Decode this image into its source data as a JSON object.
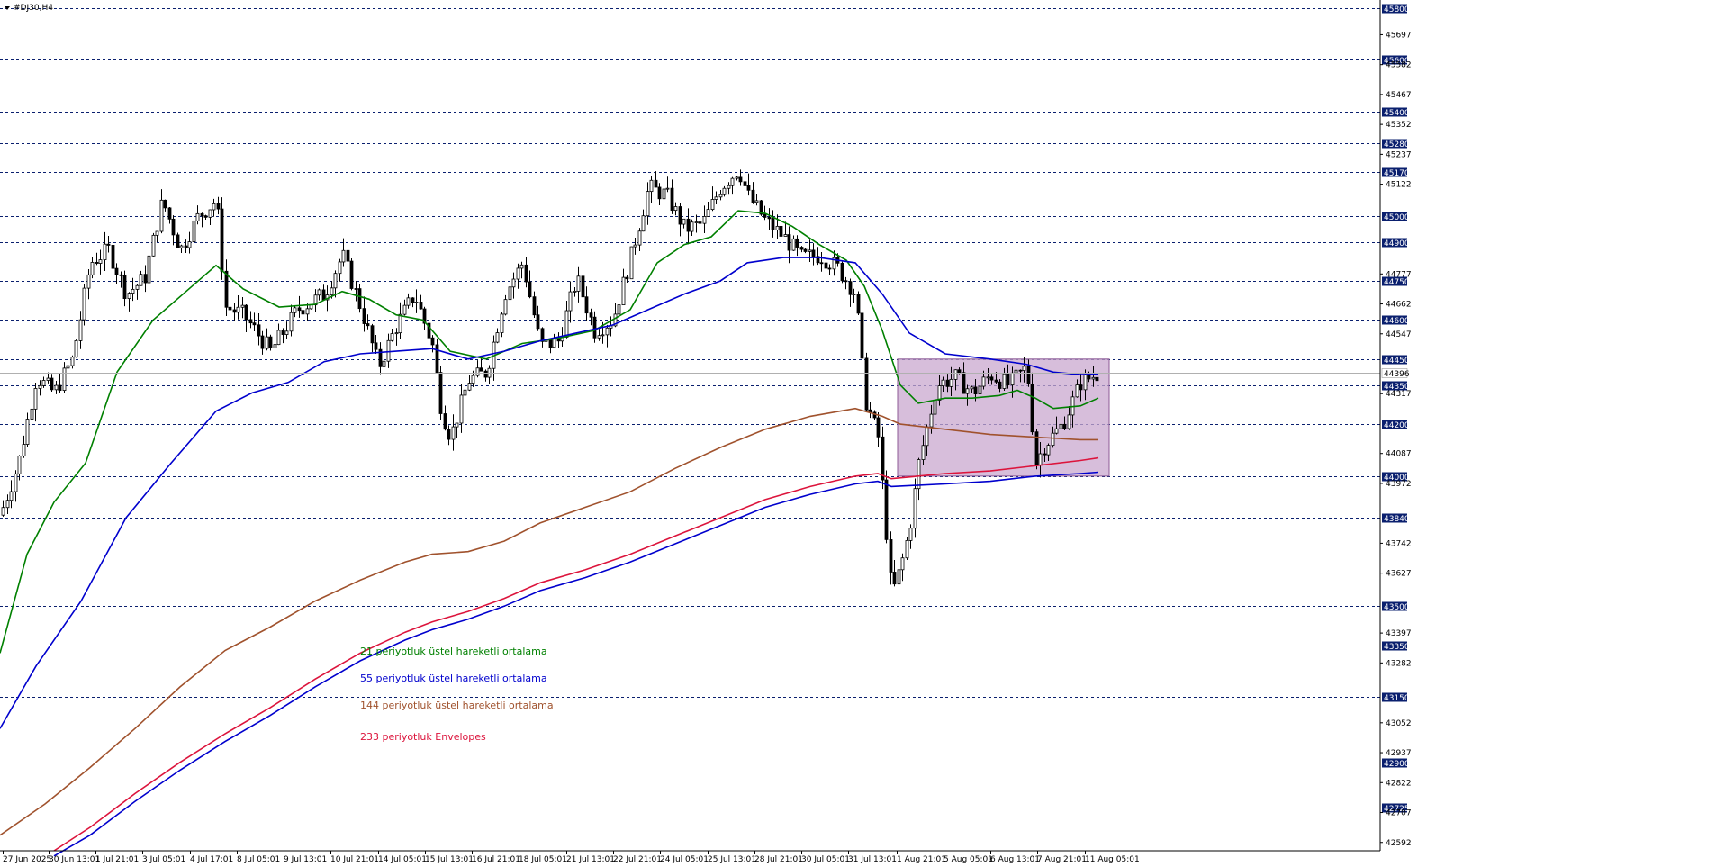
{
  "symbol": "#DJ30,H4",
  "chart_data": {
    "type": "candlestick",
    "ylim": [
      42560,
      45830
    ],
    "grid": true,
    "highlighted_levels": [
      45800,
      45600,
      45400,
      45280,
      45170,
      45000,
      44900,
      44750,
      44600,
      44450,
      44350,
      44200,
      44000,
      43840,
      43500,
      43350,
      43150,
      42900,
      42725
    ],
    "minor_levels": [
      45697,
      45582,
      45467,
      45352,
      45237,
      45122,
      44777,
      44662,
      44547,
      44317,
      44087,
      43972,
      43742,
      43627,
      43397,
      43282,
      43052,
      42937,
      42822,
      42707,
      42592
    ],
    "current_price": 44396,
    "x_labels": [
      "27 Jun 2025",
      "30 Jun 13:01",
      "1 Jul 21:01",
      "3 Jul 05:01",
      "4 Jul 17:01",
      "8 Jul 05:01",
      "9 Jul 13:01",
      "10 Jul 21:01",
      "14 Jul 05:01",
      "15 Jul 13:01",
      "16 Jul 21:01",
      "18 Jul 05:01",
      "21 Jul 13:01",
      "22 Jul 21:01",
      "24 Jul 05:01",
      "25 Jul 13:01",
      "28 Jul 21:01",
      "30 Jul 05:01",
      "31 Jul 13:01",
      "1 Aug 21:01",
      "5 Aug 05:01",
      "6 Aug 13:01",
      "7 Aug 21:01",
      "11 Aug 05:01"
    ],
    "close_path": [
      [
        0,
        43850
      ],
      [
        20,
        44050
      ],
      [
        40,
        44380
      ],
      [
        60,
        44320
      ],
      [
        80,
        44450
      ],
      [
        100,
        44820
      ],
      [
        120,
        44870
      ],
      [
        140,
        44700
      ],
      [
        160,
        44760
      ],
      [
        180,
        45060
      ],
      [
        200,
        44870
      ],
      [
        220,
        45000
      ],
      [
        240,
        45060
      ],
      [
        250,
        44650
      ],
      [
        270,
        44620
      ],
      [
        300,
        44480
      ],
      [
        330,
        44640
      ],
      [
        360,
        44700
      ],
      [
        380,
        44850
      ],
      [
        400,
        44650
      ],
      [
        420,
        44420
      ],
      [
        440,
        44580
      ],
      [
        460,
        44700
      ],
      [
        480,
        44500
      ],
      [
        490,
        44250
      ],
      [
        500,
        44150
      ],
      [
        520,
        44370
      ],
      [
        540,
        44400
      ],
      [
        560,
        44700
      ],
      [
        580,
        44820
      ],
      [
        600,
        44500
      ],
      [
        620,
        44520
      ],
      [
        640,
        44760
      ],
      [
        660,
        44560
      ],
      [
        680,
        44600
      ],
      [
        700,
        44840
      ],
      [
        720,
        45110
      ],
      [
        740,
        45080
      ],
      [
        760,
        44950
      ],
      [
        780,
        44970
      ],
      [
        800,
        45110
      ],
      [
        820,
        45180
      ],
      [
        830,
        45080
      ],
      [
        850,
        44980
      ],
      [
        870,
        44920
      ],
      [
        890,
        44840
      ],
      [
        910,
        44850
      ],
      [
        930,
        44800
      ],
      [
        950,
        44700
      ],
      [
        960,
        44300
      ],
      [
        975,
        44150
      ],
      [
        990,
        43540
      ],
      [
        1000,
        43650
      ],
      [
        1010,
        43800
      ],
      [
        1020,
        44050
      ],
      [
        1040,
        44350
      ],
      [
        1060,
        44380
      ],
      [
        1080,
        44320
      ],
      [
        1100,
        44390
      ],
      [
        1120,
        44350
      ],
      [
        1140,
        44420
      ],
      [
        1150,
        44050
      ],
      [
        1160,
        44120
      ],
      [
        1180,
        44200
      ],
      [
        1200,
        44360
      ],
      [
        1220,
        44396
      ]
    ],
    "series": [
      {
        "name": "21 periyotluk üstel hareketli ortalama",
        "color": "#008000",
        "points": [
          [
            0,
            43320
          ],
          [
            30,
            43700
          ],
          [
            60,
            43900
          ],
          [
            95,
            44050
          ],
          [
            130,
            44400
          ],
          [
            170,
            44600
          ],
          [
            210,
            44720
          ],
          [
            240,
            44810
          ],
          [
            270,
            44720
          ],
          [
            310,
            44650
          ],
          [
            350,
            44660
          ],
          [
            380,
            44710
          ],
          [
            410,
            44680
          ],
          [
            440,
            44620
          ],
          [
            470,
            44600
          ],
          [
            500,
            44480
          ],
          [
            540,
            44450
          ],
          [
            580,
            44510
          ],
          [
            620,
            44530
          ],
          [
            660,
            44560
          ],
          [
            700,
            44640
          ],
          [
            730,
            44820
          ],
          [
            760,
            44890
          ],
          [
            790,
            44920
          ],
          [
            820,
            45020
          ],
          [
            850,
            45010
          ],
          [
            880,
            44960
          ],
          [
            910,
            44890
          ],
          [
            940,
            44830
          ],
          [
            960,
            44730
          ],
          [
            980,
            44560
          ],
          [
            1000,
            44350
          ],
          [
            1020,
            44280
          ],
          [
            1050,
            44300
          ],
          [
            1080,
            44300
          ],
          [
            1110,
            44310
          ],
          [
            1130,
            44330
          ],
          [
            1150,
            44300
          ],
          [
            1170,
            44260
          ],
          [
            1200,
            44270
          ],
          [
            1220,
            44300
          ]
        ]
      },
      {
        "name": "55 periyotluk üstel hareketli ortalama",
        "color": "#0000cd",
        "points": [
          [
            0,
            43030
          ],
          [
            40,
            43270
          ],
          [
            90,
            43520
          ],
          [
            140,
            43840
          ],
          [
            190,
            44050
          ],
          [
            240,
            44250
          ],
          [
            280,
            44320
          ],
          [
            320,
            44360
          ],
          [
            360,
            44440
          ],
          [
            400,
            44470
          ],
          [
            440,
            44480
          ],
          [
            480,
            44490
          ],
          [
            520,
            44450
          ],
          [
            560,
            44480
          ],
          [
            600,
            44520
          ],
          [
            640,
            44550
          ],
          [
            680,
            44580
          ],
          [
            720,
            44640
          ],
          [
            760,
            44700
          ],
          [
            800,
            44750
          ],
          [
            830,
            44820
          ],
          [
            870,
            44840
          ],
          [
            910,
            44840
          ],
          [
            950,
            44820
          ],
          [
            980,
            44700
          ],
          [
            1010,
            44550
          ],
          [
            1050,
            44470
          ],
          [
            1100,
            44450
          ],
          [
            1140,
            44430
          ],
          [
            1170,
            44400
          ],
          [
            1200,
            44390
          ],
          [
            1220,
            44392
          ]
        ]
      },
      {
        "name": "144 periyotluk üstel hareketli ortalama",
        "color": "#a0522d",
        "points": [
          [
            0,
            42620
          ],
          [
            50,
            42740
          ],
          [
            100,
            42880
          ],
          [
            150,
            43030
          ],
          [
            200,
            43190
          ],
          [
            250,
            43330
          ],
          [
            300,
            43420
          ],
          [
            350,
            43520
          ],
          [
            400,
            43600
          ],
          [
            450,
            43670
          ],
          [
            480,
            43700
          ],
          [
            520,
            43710
          ],
          [
            560,
            43750
          ],
          [
            600,
            43820
          ],
          [
            650,
            43880
          ],
          [
            700,
            43940
          ],
          [
            750,
            44030
          ],
          [
            800,
            44110
          ],
          [
            850,
            44180
          ],
          [
            900,
            44230
          ],
          [
            950,
            44260
          ],
          [
            980,
            44230
          ],
          [
            1000,
            44200
          ],
          [
            1050,
            44180
          ],
          [
            1100,
            44160
          ],
          [
            1150,
            44150
          ],
          [
            1200,
            44140
          ],
          [
            1220,
            44140
          ]
        ]
      },
      {
        "name": "233 periyotluk Envelopes",
        "color": "#dc143c",
        "points": [
          [
            60,
            42560
          ],
          [
            100,
            42650
          ],
          [
            150,
            42780
          ],
          [
            200,
            42900
          ],
          [
            250,
            43010
          ],
          [
            300,
            43110
          ],
          [
            350,
            43220
          ],
          [
            400,
            43320
          ],
          [
            450,
            43400
          ],
          [
            480,
            43440
          ],
          [
            520,
            43480
          ],
          [
            560,
            43530
          ],
          [
            600,
            43590
          ],
          [
            650,
            43640
          ],
          [
            700,
            43700
          ],
          [
            750,
            43770
          ],
          [
            800,
            43840
          ],
          [
            850,
            43910
          ],
          [
            900,
            43960
          ],
          [
            950,
            44000
          ],
          [
            975,
            44010
          ],
          [
            990,
            43990
          ],
          [
            1050,
            44010
          ],
          [
            1100,
            44020
          ],
          [
            1150,
            44040
          ],
          [
            1200,
            44060
          ],
          [
            1220,
            44070
          ]
        ]
      },
      {
        "name": "",
        "color": "#0000cd",
        "points": [
          [
            60,
            42540
          ],
          [
            100,
            42620
          ],
          [
            150,
            42750
          ],
          [
            200,
            42870
          ],
          [
            250,
            42980
          ],
          [
            300,
            43080
          ],
          [
            350,
            43190
          ],
          [
            400,
            43290
          ],
          [
            450,
            43370
          ],
          [
            480,
            43410
          ],
          [
            520,
            43450
          ],
          [
            560,
            43500
          ],
          [
            600,
            43560
          ],
          [
            650,
            43610
          ],
          [
            700,
            43670
          ],
          [
            750,
            43740
          ],
          [
            800,
            43810
          ],
          [
            850,
            43880
          ],
          [
            900,
            43930
          ],
          [
            950,
            43970
          ],
          [
            975,
            43980
          ],
          [
            990,
            43960
          ],
          [
            1050,
            43970
          ],
          [
            1100,
            43980
          ],
          [
            1150,
            44000
          ],
          [
            1200,
            44010
          ],
          [
            1220,
            44015
          ]
        ]
      }
    ],
    "range_box": {
      "x_from": 997,
      "x_to": 1232,
      "y_from": 44000,
      "y_to": 44450
    }
  },
  "legend": [
    {
      "text": "21 periyotluk üstel hareketli ortalama",
      "color": "#008000"
    },
    {
      "text": "55 periyotluk üstel hareketli ortalama",
      "color": "#0000cd"
    },
    {
      "text": "144 periyotluk üstel hareketli ortalama",
      "color": "#a0522d"
    },
    {
      "text": "233 periyotluk Envelopes",
      "color": "#dc143c"
    }
  ],
  "colors": {
    "grid": "#0a1f6e",
    "tag_bg": "#0a1f6e",
    "box_fill": "#c9a8cf",
    "box_stroke": "#8c5a96"
  }
}
